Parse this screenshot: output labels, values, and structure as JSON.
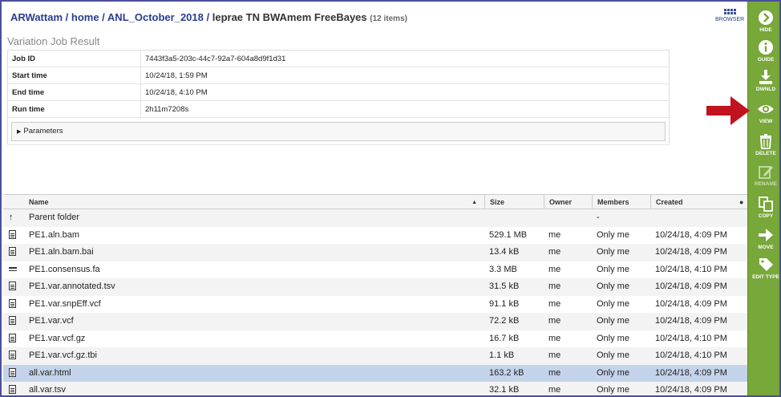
{
  "breadcrumb": {
    "parts": [
      "ARWattam",
      "home",
      "ANL_October_2018"
    ],
    "current": "leprae TN BWAmem FreeBayes",
    "count": "(12 items)"
  },
  "browser_button": {
    "label": "BROWSER",
    "icon": "grid-icon"
  },
  "job": {
    "title": "Variation Job Result",
    "rows": [
      {
        "key": "Job ID",
        "value": "7443f3a5-203c-44c7-92a7-604a8d9f1d31"
      },
      {
        "key": "Start time",
        "value": "10/24/18, 1:59 PM"
      },
      {
        "key": "End time",
        "value": "10/24/18, 4:10 PM"
      },
      {
        "key": "Run time",
        "value": "2h11m7208s"
      }
    ],
    "parameters_label": "Parameters"
  },
  "grid": {
    "headers": {
      "name": "Name",
      "size": "Size",
      "owner": "Owner",
      "members": "Members",
      "created": "Created"
    },
    "rows": [
      {
        "icon": "up-arrow-icon",
        "name": "Parent folder",
        "size": "",
        "owner": "",
        "members": "-",
        "created": ""
      },
      {
        "icon": "document-icon",
        "name": "PE1.aln.bam",
        "size": "529.1 MB",
        "owner": "me",
        "members": "Only me",
        "created": "10/24/18, 4:09 PM"
      },
      {
        "icon": "document-icon",
        "name": "PE1.aln.bam.bai",
        "size": "13.4 kB",
        "owner": "me",
        "members": "Only me",
        "created": "10/24/18, 4:09 PM"
      },
      {
        "icon": "fasta-icon",
        "name": "PE1.consensus.fa",
        "size": "3.3 MB",
        "owner": "me",
        "members": "Only me",
        "created": "10/24/18, 4:10 PM"
      },
      {
        "icon": "document-icon",
        "name": "PE1.var.annotated.tsv",
        "size": "31.5 kB",
        "owner": "me",
        "members": "Only me",
        "created": "10/24/18, 4:09 PM"
      },
      {
        "icon": "document-icon",
        "name": "PE1.var.snpEff.vcf",
        "size": "91.1 kB",
        "owner": "me",
        "members": "Only me",
        "created": "10/24/18, 4:09 PM"
      },
      {
        "icon": "document-icon",
        "name": "PE1.var.vcf",
        "size": "72.2 kB",
        "owner": "me",
        "members": "Only me",
        "created": "10/24/18, 4:09 PM"
      },
      {
        "icon": "document-icon",
        "name": "PE1.var.vcf.gz",
        "size": "16.7 kB",
        "owner": "me",
        "members": "Only me",
        "created": "10/24/18, 4:10 PM"
      },
      {
        "icon": "document-icon",
        "name": "PE1.var.vcf.gz.tbi",
        "size": "1.1 kB",
        "owner": "me",
        "members": "Only me",
        "created": "10/24/18, 4:10 PM"
      },
      {
        "icon": "document-icon",
        "name": "all.var.html",
        "size": "163.2 kB",
        "owner": "me",
        "members": "Only me",
        "created": "10/24/18, 4:09 PM",
        "selected": true
      },
      {
        "icon": "document-icon",
        "name": "all.var.tsv",
        "size": "32.1 kB",
        "owner": "me",
        "members": "Only me",
        "created": "10/24/18, 4:09 PM"
      }
    ]
  },
  "sidebar": {
    "buttons": [
      {
        "label": "HIDE",
        "icon": "chevron-right-circle-icon"
      },
      {
        "label": "GUIDE",
        "icon": "info-icon"
      },
      {
        "label": "DWNLD",
        "icon": "download-icon"
      },
      {
        "label": "VIEW",
        "icon": "eye-icon"
      },
      {
        "label": "DELETE",
        "icon": "trash-icon"
      },
      {
        "label": "RENAME",
        "icon": "pencil-icon",
        "disabled": true
      },
      {
        "label": "COPY",
        "icon": "copy-icon"
      },
      {
        "label": "MOVE",
        "icon": "arrow-right-icon"
      },
      {
        "label": "EDIT TYPE",
        "icon": "tag-icon"
      }
    ]
  },
  "colors": {
    "sidebar": "#78a73a",
    "selected_row": "#c3d4ea",
    "breadcrumb": "#2a3d8f",
    "pointer_arrow": "#c1121f",
    "frame": "#4a4f9c"
  }
}
